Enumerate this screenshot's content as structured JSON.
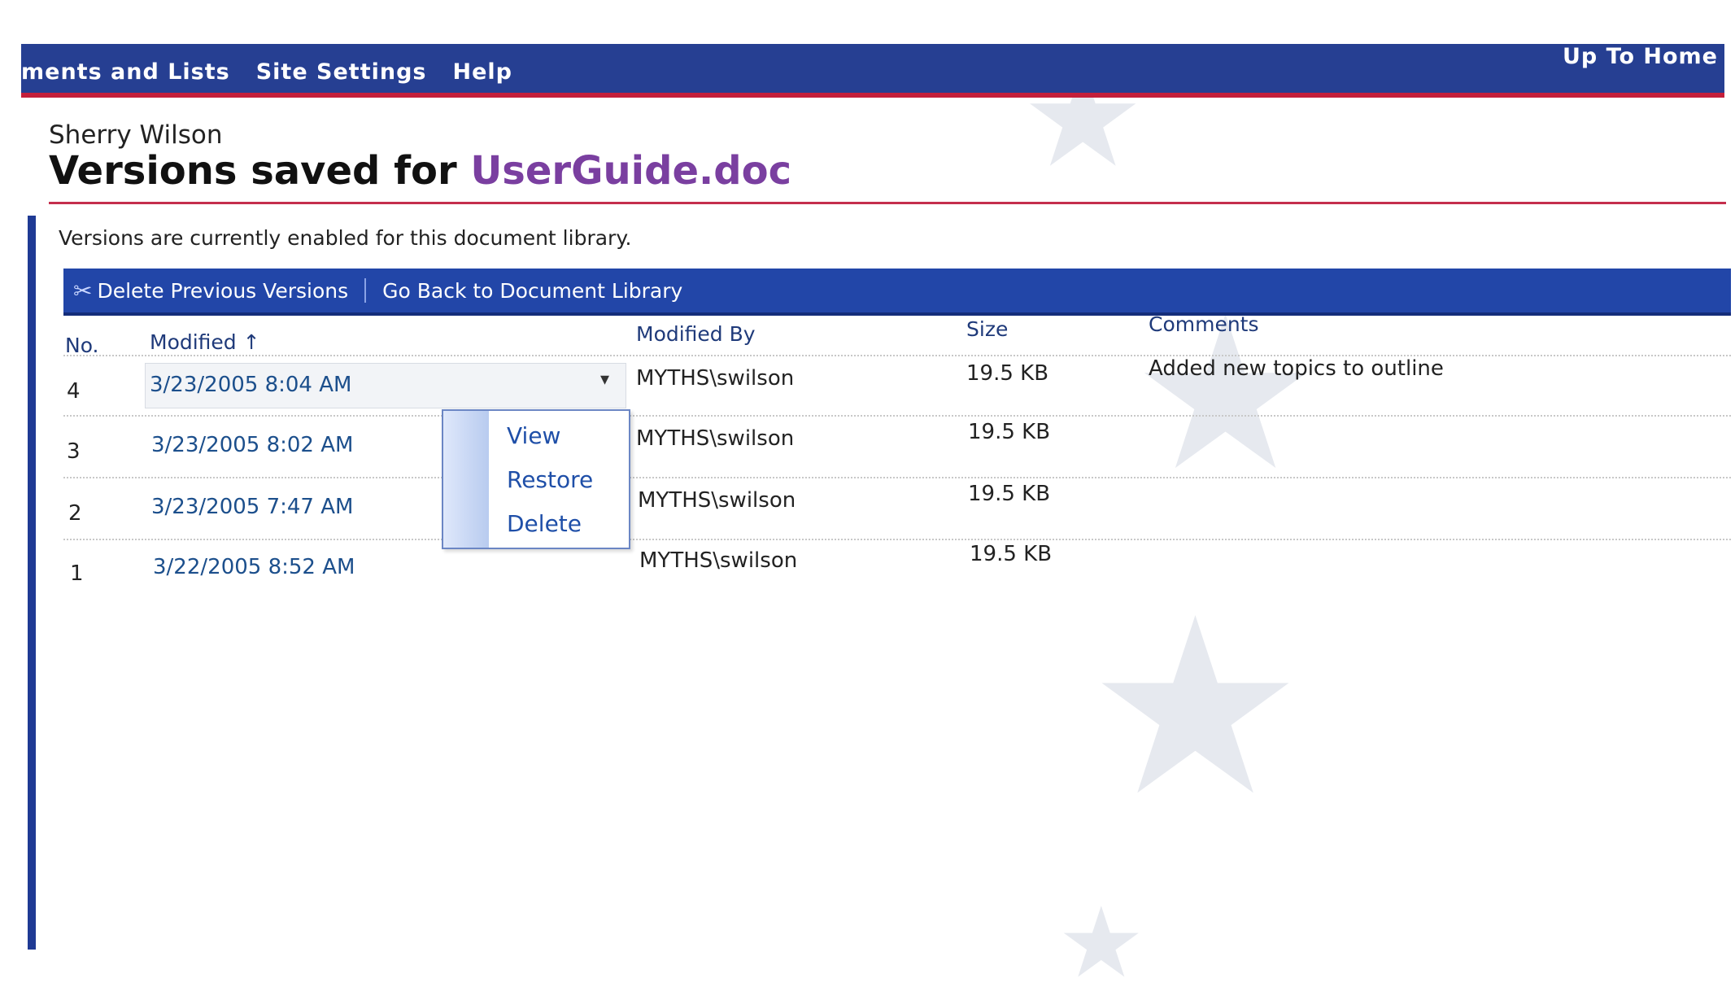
{
  "nav": {
    "items": [
      "ments and Lists",
      "Site Settings",
      "Help"
    ],
    "up_to_home": "Up To Home"
  },
  "header": {
    "user": "Sherry Wilson",
    "title_prefix": "Versions saved for ",
    "document_name": "UserGuide.doc"
  },
  "info": "Versions are currently enabled for this document library.",
  "toolbar": {
    "delete_previous": "Delete Previous Versions",
    "go_back": "Go Back to Document Library"
  },
  "table": {
    "headers": {
      "no": "No.",
      "modified": "Modified ↑",
      "modified_by": "Modified By",
      "size": "Size",
      "comments": "Comments"
    },
    "rows": [
      {
        "no": "4",
        "modified": "3/23/2005 8:04 AM",
        "modified_by": "MYTHS\\swilson",
        "size": "19.5 KB",
        "comments": "Added new topics to outline"
      },
      {
        "no": "3",
        "modified": "3/23/2005 8:02 AM",
        "modified_by": "MYTHS\\swilson",
        "size": "19.5 KB",
        "comments": ""
      },
      {
        "no": "2",
        "modified": "3/23/2005 7:47 AM",
        "modified_by": "MYTHS\\swilson",
        "size": "19.5 KB",
        "comments": ""
      },
      {
        "no": "1",
        "modified": "3/22/2005 8:52 AM",
        "modified_by": "MYTHS\\swilson",
        "size": "19.5 KB",
        "comments": ""
      }
    ]
  },
  "context_menu": {
    "items": [
      "View",
      "Restore",
      "Delete"
    ]
  },
  "colors": {
    "nav_bar": "#263f92",
    "accent_red": "#c41f3b",
    "document_name": "#7a3fa0",
    "toolbar": "#2246a8"
  }
}
